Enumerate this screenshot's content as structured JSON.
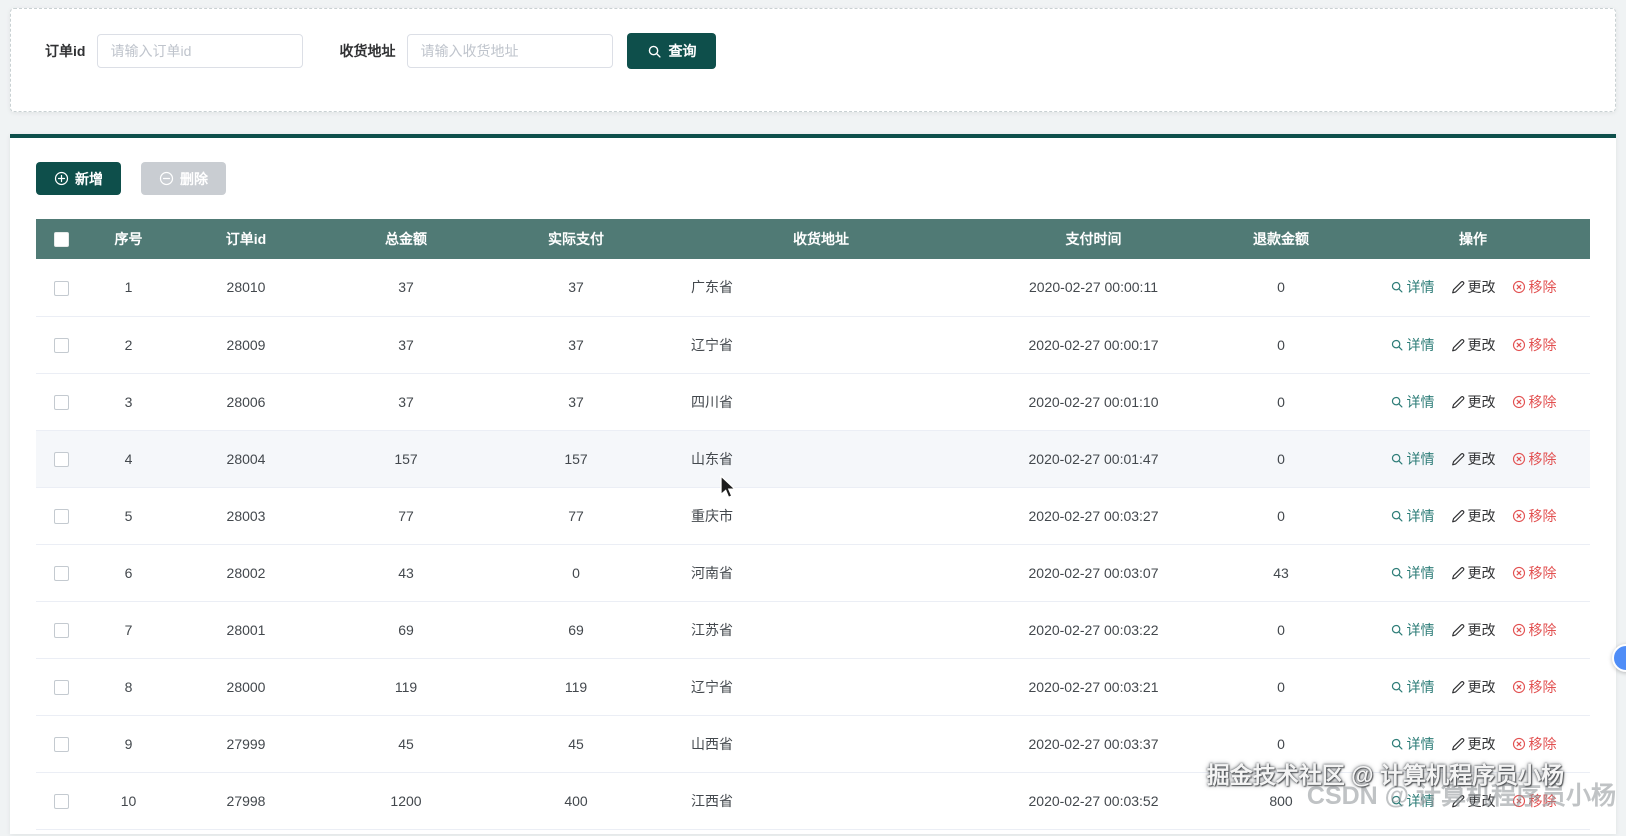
{
  "search": {
    "order_id": {
      "label": "订单id",
      "placeholder": "请输入订单id",
      "value": ""
    },
    "address": {
      "label": "收货地址",
      "placeholder": "请输入收货地址",
      "value": ""
    },
    "query_button": "查询"
  },
  "toolbar": {
    "add_button": "新增",
    "delete_button": "删除"
  },
  "table": {
    "headers": {
      "index": "序号",
      "order_id": "订单id",
      "total": "总金额",
      "paid": "实际支付",
      "address": "收货地址",
      "pay_time": "支付时间",
      "refund": "退款金额",
      "actions": "操作"
    },
    "action_labels": {
      "detail": "详情",
      "edit": "更改",
      "remove": "移除"
    },
    "rows": [
      {
        "index": "1",
        "order_id": "28010",
        "total": "37",
        "paid": "37",
        "address": "广东省",
        "pay_time": "2020-02-27 00:00:11",
        "refund": "0",
        "hover": false
      },
      {
        "index": "2",
        "order_id": "28009",
        "total": "37",
        "paid": "37",
        "address": "辽宁省",
        "pay_time": "2020-02-27 00:00:17",
        "refund": "0",
        "hover": false
      },
      {
        "index": "3",
        "order_id": "28006",
        "total": "37",
        "paid": "37",
        "address": "四川省",
        "pay_time": "2020-02-27 00:01:10",
        "refund": "0",
        "hover": false
      },
      {
        "index": "4",
        "order_id": "28004",
        "total": "157",
        "paid": "157",
        "address": "山东省",
        "pay_time": "2020-02-27 00:01:47",
        "refund": "0",
        "hover": true
      },
      {
        "index": "5",
        "order_id": "28003",
        "total": "77",
        "paid": "77",
        "address": "重庆市",
        "pay_time": "2020-02-27 00:03:27",
        "refund": "0",
        "hover": false
      },
      {
        "index": "6",
        "order_id": "28002",
        "total": "43",
        "paid": "0",
        "address": "河南省",
        "pay_time": "2020-02-27 00:03:07",
        "refund": "43",
        "hover": false
      },
      {
        "index": "7",
        "order_id": "28001",
        "total": "69",
        "paid": "69",
        "address": "江苏省",
        "pay_time": "2020-02-27 00:03:22",
        "refund": "0",
        "hover": false
      },
      {
        "index": "8",
        "order_id": "28000",
        "total": "119",
        "paid": "119",
        "address": "辽宁省",
        "pay_time": "2020-02-27 00:03:21",
        "refund": "0",
        "hover": false
      },
      {
        "index": "9",
        "order_id": "27999",
        "total": "45",
        "paid": "45",
        "address": "山西省",
        "pay_time": "2020-02-27 00:03:37",
        "refund": "0",
        "hover": false
      },
      {
        "index": "10",
        "order_id": "27998",
        "total": "1200",
        "paid": "400",
        "address": "江西省",
        "pay_time": "2020-02-27 00:03:52",
        "refund": "800",
        "hover": false
      }
    ]
  },
  "watermark": {
    "primary": "掘金技术社区 @ 计算机程序员小杨",
    "secondary": "CSDN @ 计算机程序员小杨"
  },
  "colors": {
    "theme": "#0e4f4b",
    "table_header_bg": "#507a75",
    "detail_link": "#2e7d78",
    "edit_link": "#303133",
    "remove_link": "#e25050",
    "disabled_button": "#c9cdd2",
    "float_badge": "#4f8df7"
  }
}
